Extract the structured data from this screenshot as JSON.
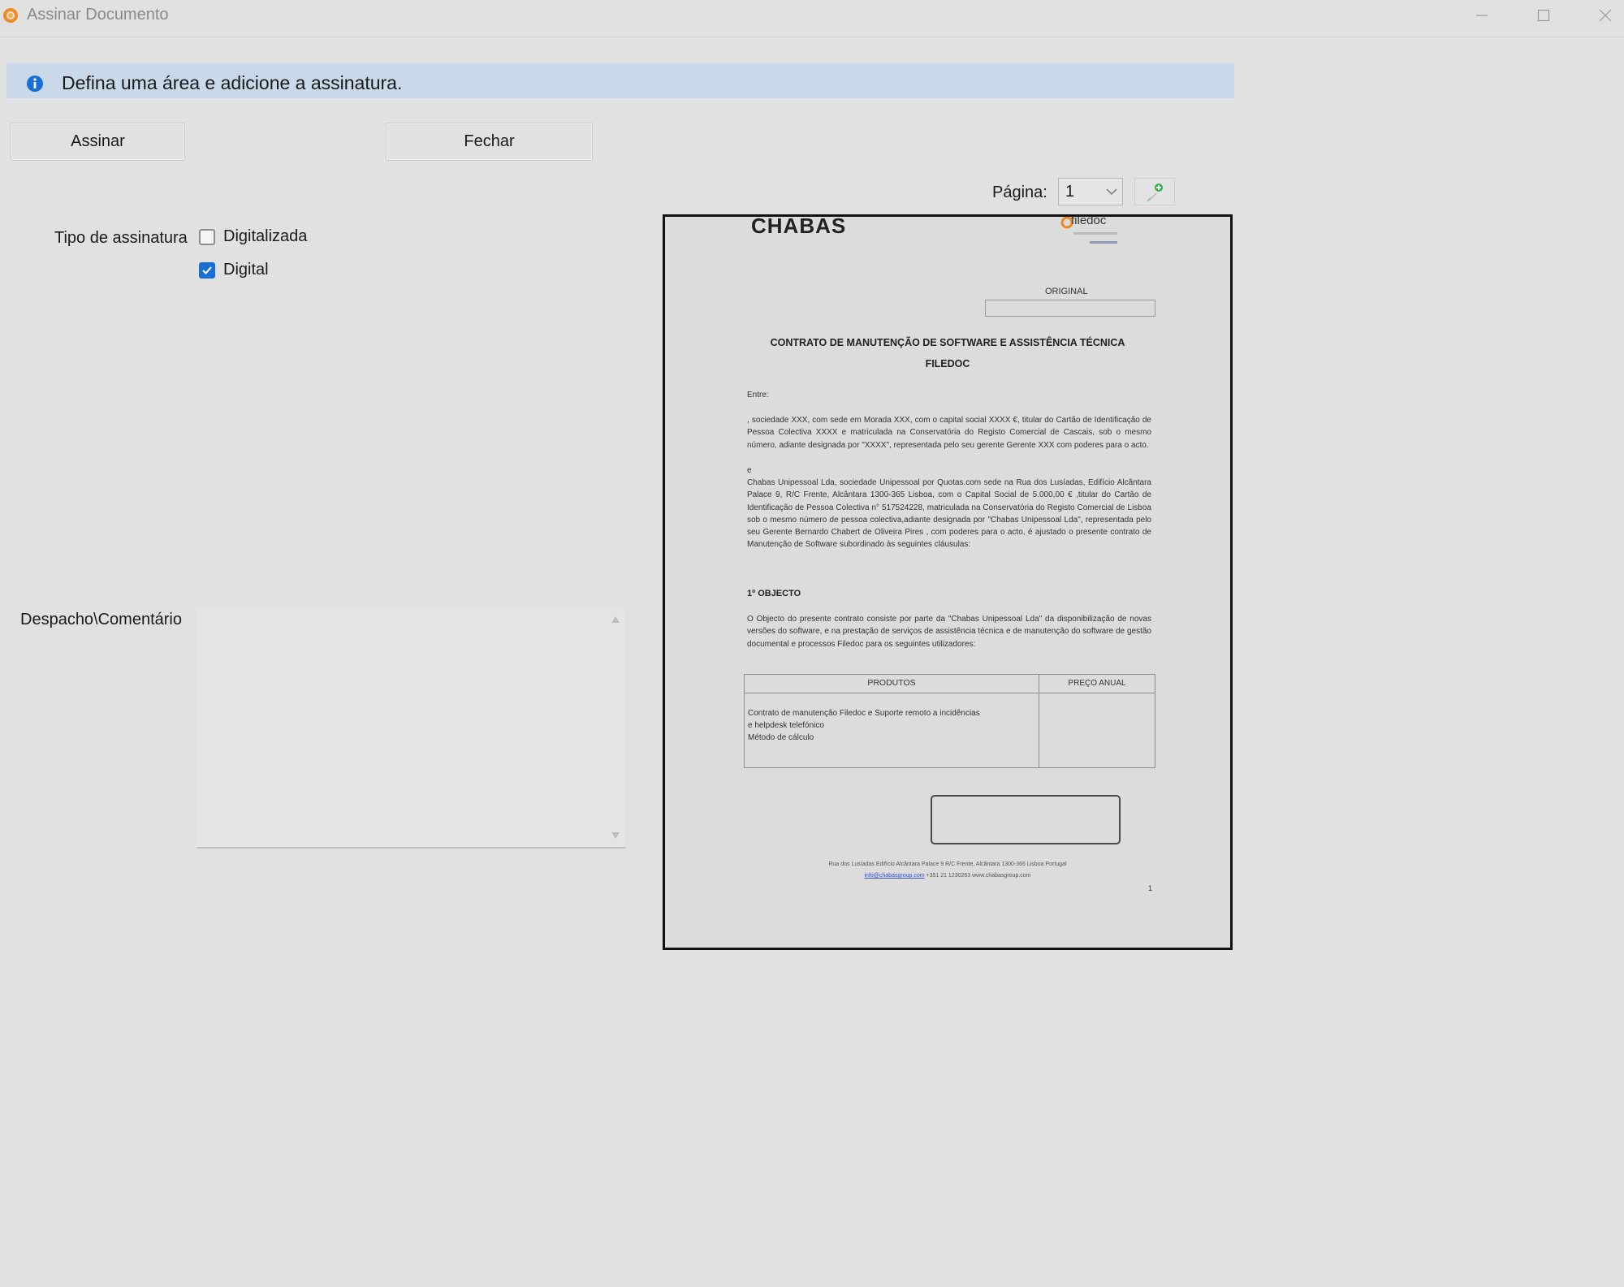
{
  "window": {
    "title": "Assinar Documento"
  },
  "banner": {
    "message": "Defina uma área e adicione a assinatura."
  },
  "buttons": {
    "sign": "Assinar",
    "close": "Fechar"
  },
  "signature_type": {
    "label": "Tipo de assinatura",
    "options": [
      {
        "label": "Digitalizada",
        "checked": false
      },
      {
        "label": "Digital",
        "checked": true
      }
    ]
  },
  "comment": {
    "label": "Despacho\\Comentário",
    "value": ""
  },
  "page_selector": {
    "label": "Página:",
    "value": "1"
  },
  "document": {
    "brand": "CHABAS",
    "filedoc_logo": "filedoc",
    "original_label": "ORIGINAL",
    "title_line1": "CONTRATO DE MANUTENÇÃO DE SOFTWARE E ASSISTÊNCIA TÉCNICA",
    "title_line2": "FILEDOC",
    "entre": "Entre:",
    "party1": ", sociedade XXX, com sede em Morada XXX, com o capital social XXXX €, titular do Cartão de Identificação de Pessoa Colectiva XXXX e matriculada na Conservatória do Registo Comercial de Cascais, sob o mesmo número, adiante designada por \"XXXX\", representada pelo seu gerente Gerente XXX com poderes para o acto.",
    "e": "e",
    "party2": "Chabas Unipessoal Lda, sociedade Unipessoal por Quotas.com sede na Rua dos Lusíadas, Edifício Alcântara Palace 9, R/C Frente, Alcântara 1300-365 Lisboa, com o Capital Social de 5.000,00 € ,titular do Cartão de Identificação de Pessoa Colectiva n° 517524228, matriculada na Conservatória do Registo Comercial de Lisboa sob o mesmo número de pessoa colectiva,adiante designada por \"Chabas Unipessoal Lda\", representada pelo seu Gerente Bernardo Chabert de Oliveira Pires , com poderes para o acto, é ajustado o presente contrato de Manutenção de Software subordinado às seguintes cláusulas:",
    "section1_title": "1º OBJECTO",
    "section1_text": "O Objecto do presente contrato consiste por parte da \"Chabas Unipessoal Lda\" da disponibilização de novas versões do software, e na prestação de serviços de assistência técnica e de manutenção do software de gestão documental e processos Filedoc para os seguintes utilizadores:",
    "table": {
      "headers": [
        "PRODUTOS",
        "PREÇO ANUAL"
      ],
      "row_line1": "Contrato de manutenção Filedoc e Suporte remoto a incidências",
      "row_line2": "e helpdesk telefónico",
      "row_line3": "Método de cálculo"
    },
    "footer_line1": "Rua dos Lusíadas Edifício Alcântara Palace 9 R/C Frente, Alcântara 1300-365 Lisboa Portugal",
    "footer_email": "info@chabasgroup.com",
    "footer_line2_rest": " +351 21 1230263 www.chabasgroup.com",
    "page_number": "1"
  },
  "colors": {
    "accent": "#1a6fd4",
    "banner": "#c9d9ea",
    "background": "#e1e1e1"
  },
  "icons": [
    "app-logo-icon",
    "info-icon",
    "minimize-icon",
    "maximize-icon",
    "close-icon",
    "chevron-down-icon",
    "add-page-icon"
  ]
}
